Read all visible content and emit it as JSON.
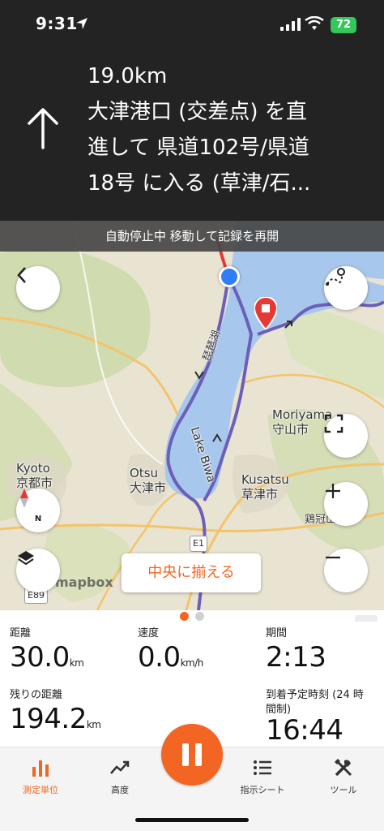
{
  "status_bar": {
    "time": "9:31",
    "battery": "72"
  },
  "navigation": {
    "distance": "19.0km",
    "instruction_lines": [
      "大津港口 (交差点) を直",
      "進して 県道102号/県道",
      "18号 に入る (草津/石..."
    ]
  },
  "autopause_banner": "自動停止中 移動して記録を再開",
  "map": {
    "labels": {
      "kyoto": "Kyoto",
      "kyoto_jp": "京都市",
      "otsu": "Otsu",
      "otsu_jp": "大津市",
      "moriyama": "Moriyama",
      "moriyama_jp": "守山市",
      "kusatsu": "Kusatsu",
      "kusatsu_jp": "草津市",
      "lake_biwa": "Lake Biwa",
      "lake_biwa_jp": "琵琶湖",
      "keikan": "鶏冠山",
      "e1": "E1",
      "e89": "E89"
    },
    "mapbox": "mapbox",
    "center_button": "中央に揃える",
    "compass_label": "N"
  },
  "pager": {
    "count": 2,
    "active": 0
  },
  "metrics": {
    "distance": {
      "label": "距離",
      "value": "30.0",
      "unit": "km"
    },
    "speed": {
      "label": "速度",
      "value": "0.0",
      "unit": "km/h"
    },
    "duration": {
      "label": "期間",
      "value": "2:13"
    },
    "remaining": {
      "label": "残りの距離",
      "value": "194.2",
      "unit": "km"
    },
    "eta": {
      "label_line1": "到着予定時刻 (24 時",
      "label_line2": "間制)",
      "value": "16:44"
    }
  },
  "tabs": [
    {
      "label": "測定単位",
      "icon": "bar-chart-icon",
      "active": true
    },
    {
      "label": "高度",
      "icon": "trend-line-icon",
      "active": false
    },
    {
      "label": "指示シート",
      "icon": "list-icon",
      "active": false
    },
    {
      "label": "ツール",
      "icon": "tools-icon",
      "active": false
    }
  ],
  "colors": {
    "accent": "#f26522",
    "route": "#6b5fb8",
    "lake": "#aac8ee",
    "banner": "#232323"
  }
}
